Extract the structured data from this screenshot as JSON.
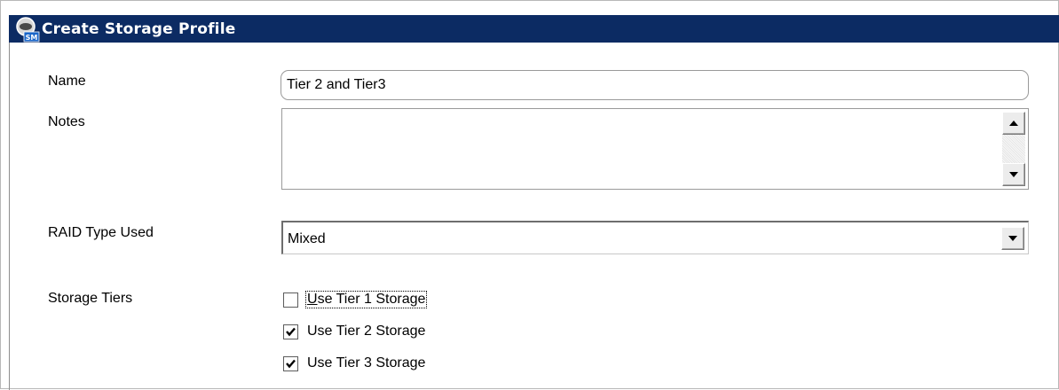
{
  "window": {
    "title": "Create Storage Profile",
    "icon": "dell-storage-manager-icon",
    "titlebar_color": "#0c2b63"
  },
  "form": {
    "name": {
      "label": "Name",
      "value": "Tier 2 and Tier3"
    },
    "notes": {
      "label": "Notes",
      "value": ""
    },
    "raid": {
      "label": "RAID Type Used",
      "selected": "Mixed"
    },
    "tiers": {
      "label": "Storage Tiers",
      "items": [
        {
          "mnemonic": "U",
          "rest": "se Tier 1 Storage",
          "checked": false,
          "focused": true
        },
        {
          "mnemonic": "",
          "rest": "Use Tier 2 Storage",
          "checked": true,
          "focused": false
        },
        {
          "mnemonic": "",
          "rest": "Use Tier 3 Storage",
          "checked": true,
          "focused": false
        }
      ]
    }
  }
}
